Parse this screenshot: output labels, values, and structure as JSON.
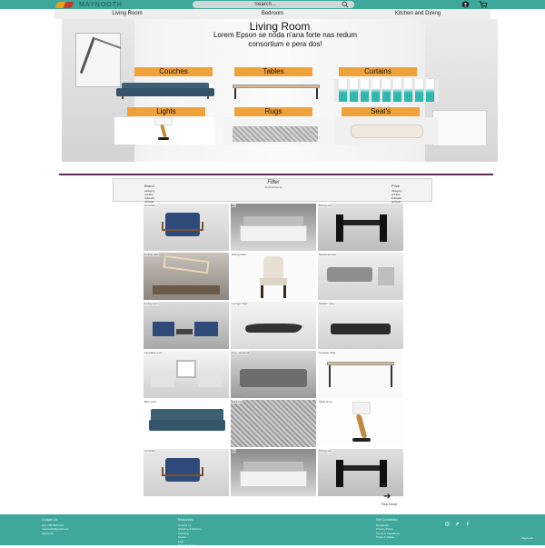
{
  "header": {
    "brand": "MAYNOOTH",
    "search_placeholder": "Search...",
    "icons": [
      "search-icon",
      "user-icon",
      "cart-icon"
    ]
  },
  "nav": {
    "items": [
      {
        "label": "Living Room"
      },
      {
        "label": "Bedroom"
      },
      {
        "label": "Kitchen and Dining"
      }
    ]
  },
  "hero": {
    "title": "Living Room",
    "subtitle": "Lorem Epson se noda n'ana forte nas redum consortium e pera dos!",
    "categories": [
      {
        "label": "Couches"
      },
      {
        "label": "Tables"
      },
      {
        "label": "Curtains"
      },
      {
        "label": "Lights"
      },
      {
        "label": "Rugs"
      },
      {
        "label": "Seat's"
      }
    ]
  },
  "filter": {
    "title": "Filter",
    "subtitle": "Sort/narrow by",
    "columns": [
      {
        "heading": "Brand",
        "items": [
          "category",
          "subtitle",
          "indicator",
          "activate"
        ]
      },
      {
        "heading": "Price",
        "items": [
          "category",
          "subtitle",
          "indicator",
          "activate"
        ]
      }
    ]
  },
  "products": [
    {
      "caption": "Armchair"
    },
    {
      "caption": "Bed"
    },
    {
      "caption": "Dining set"
    },
    {
      "caption": "Ceiling light"
    },
    {
      "caption": "Dining chair"
    },
    {
      "caption": "Sectional sofa"
    },
    {
      "caption": "Living room"
    },
    {
      "caption": "Lounge chair"
    },
    {
      "caption": "Modern sofa"
    },
    {
      "caption": "Fireplace room"
    },
    {
      "caption": "Grey sectional"
    },
    {
      "caption": "Console table"
    },
    {
      "caption": "Blue sofa"
    },
    {
      "caption": "Area rug"
    },
    {
      "caption": "Table lamp"
    },
    {
      "caption": "Armchair"
    },
    {
      "caption": "Bed"
    },
    {
      "caption": "Dining set"
    }
  ],
  "see_more": {
    "label": "See More"
  },
  "footer": {
    "columns": [
      {
        "heading": "Contact Us",
        "lines": [
          "(01) 708 6000 Ext",
          "maynooth@gmail.com",
          "Maynooth"
        ]
      },
      {
        "heading": "Resources",
        "lines": [
          "Contact us",
          "Shipping & Returns",
          "Shipping",
          "Orders",
          "FAQ",
          "Delivery Terms"
        ]
      },
      {
        "heading": "Get Connected",
        "lines": [
          "Newsletter",
          "Privacy Policy",
          "Terms & Conditions",
          "Press & Media"
        ]
      }
    ],
    "social": [
      "instagram-icon",
      "twitter-icon",
      "facebook-icon"
    ],
    "copyright": "Maynooth"
  },
  "colors": {
    "brand_teal": "#3fa89a",
    "accent_orange": "#f0a23a",
    "divider_purple": "#5e2a5c"
  }
}
